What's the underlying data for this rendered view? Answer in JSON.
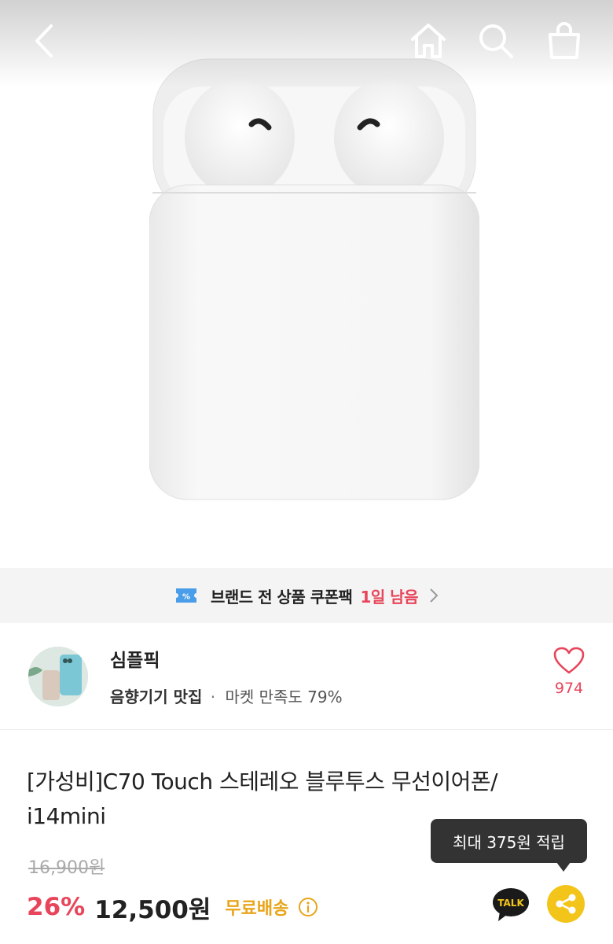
{
  "coupon_banner": {
    "text": "브랜드 전 상품 쿠폰팩",
    "remaining": "1일 남음"
  },
  "store": {
    "name": "심플픽",
    "category": "음향기기 맛집",
    "separator": "·",
    "satisfaction": "마켓 만족도 79%",
    "likes": "974"
  },
  "product": {
    "title": "[가성비]C70 Touch 스테레오 블루투스 무선이어폰/ i14mini",
    "original_price": "16,900원",
    "discount": "26%",
    "price": "12,500원",
    "shipping": "무료배송",
    "points_tooltip": "최대 375원 적립"
  },
  "icons": {
    "back": "chevron-left-icon",
    "home": "home-icon",
    "search": "search-icon",
    "cart": "shopping-bag-icon",
    "coupon": "coupon-icon",
    "like": "heart-icon",
    "talk": "kakao-talk-icon",
    "share": "share-icon",
    "info": "info-icon"
  },
  "colors": {
    "accent_red": "#e8455a",
    "shipping_yellow": "#e9a51a",
    "coupon_blue": "#4a9de8",
    "share_yellow": "#f3c51b"
  }
}
